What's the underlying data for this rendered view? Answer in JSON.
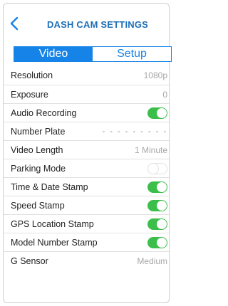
{
  "header": {
    "title": "DASH CAM SETTINGS",
    "back_icon": "chevron-left-icon",
    "accent_color": "#1f6fb7"
  },
  "tabs": [
    {
      "label": "Video",
      "active": true
    },
    {
      "label": "Setup",
      "active": false
    }
  ],
  "settings": [
    {
      "label": "Resolution",
      "value": "1080p"
    },
    {
      "label": "Exposure",
      "value": "0"
    },
    {
      "label": "Audio Recording",
      "toggle": "on"
    },
    {
      "label": "Number Plate",
      "value": "- - - - - - - - -"
    },
    {
      "label": "Video Length",
      "value": "1 Minute"
    },
    {
      "label": "Parking Mode",
      "toggle": "off"
    },
    {
      "label": "Time & Date Stamp",
      "toggle": "on"
    },
    {
      "label": "Speed Stamp",
      "toggle": "on"
    },
    {
      "label": "GPS Location Stamp",
      "toggle": "on"
    },
    {
      "label": "Model Number Stamp",
      "toggle": "on"
    },
    {
      "label": "G Sensor",
      "value": "Medium"
    }
  ],
  "colors": {
    "tab_blue": "#1683e8",
    "toggle_on": "#3bbf4a",
    "value_gray": "#a7a7a7"
  }
}
